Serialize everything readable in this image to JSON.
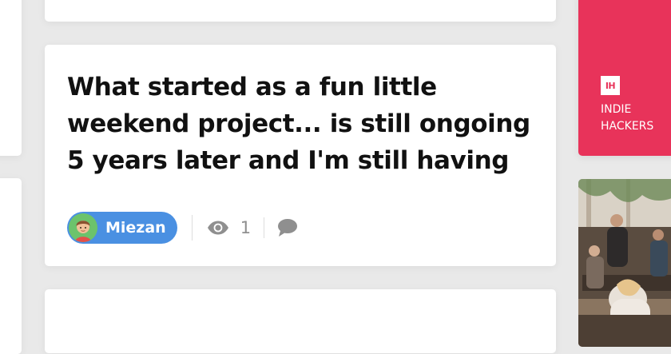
{
  "post": {
    "title": "What started as a fun little weekend project... is still ongoing 5 years later and I'm still having",
    "author": "Miezan",
    "views": "1"
  },
  "promo": {
    "logo": "IH",
    "name": "INDIE HACKERS"
  },
  "icons": {
    "avatar": "avatar-icon",
    "views": "eye-icon",
    "comments": "comment-icon"
  },
  "colors": {
    "author_pill": "#4a90e2",
    "promo_bg": "#e8335a",
    "title_text": "#111111",
    "muted": "#8f8f8f",
    "page_bg": "#e9e9e9"
  }
}
